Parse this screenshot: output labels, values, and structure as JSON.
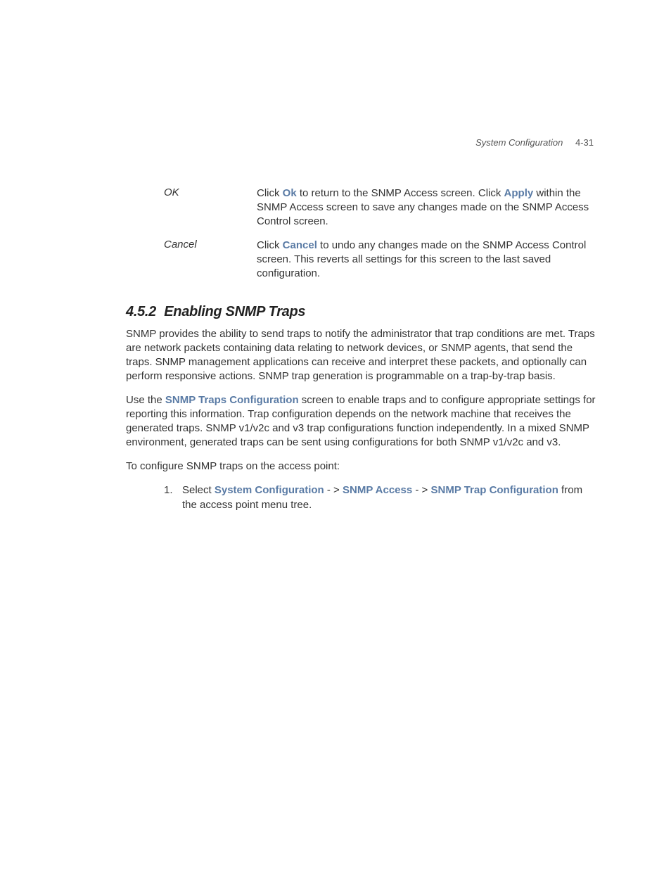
{
  "header": {
    "section_name": "System Configuration",
    "page_number": "4-31"
  },
  "definitions": [
    {
      "term": "OK",
      "desc_pre": "Click ",
      "link1": "Ok",
      "desc_mid": " to return to the SNMP Access screen. Click ",
      "link2": "Apply",
      "desc_post": " within the SNMP Access screen to save any changes made on the SNMP Access Control screen."
    },
    {
      "term": "Cancel",
      "desc_pre": "Click ",
      "link1": "Cancel",
      "desc_post": " to undo any changes made on the SNMP Access Control screen. This reverts all settings for this screen to the last saved configuration."
    }
  ],
  "section": {
    "number": "4.5.2",
    "title": "Enabling SNMP Traps"
  },
  "paragraphs": {
    "p1": "SNMP provides the ability to send traps to notify the administrator that trap conditions are met. Traps are network packets containing data relating to network devices, or SNMP agents, that send the traps. SNMP management applications can receive and interpret these packets, and optionally can perform responsive actions. SNMP trap generation is programmable on a trap-by-trap basis.",
    "p2_pre": "Use the ",
    "p2_link": "SNMP Traps Configuration",
    "p2_post": " screen to enable traps and to configure appropriate settings for reporting this information. Trap configuration depends on the network machine that receives the generated traps. SNMP v1/v2c and v3 trap configurations function independently. In a mixed SNMP environment, generated traps can be sent using configurations for both SNMP v1/v2c and v3.",
    "p3": "To configure SNMP traps on the access point:"
  },
  "steps": [
    {
      "num": "1.",
      "pre": "Select ",
      "link1": "System Configuration",
      "sep1": " - > ",
      "link2": "SNMP Access",
      "sep2": " - > ",
      "link3": "SNMP Trap Configuration",
      "post": " from the access point menu tree."
    }
  ]
}
